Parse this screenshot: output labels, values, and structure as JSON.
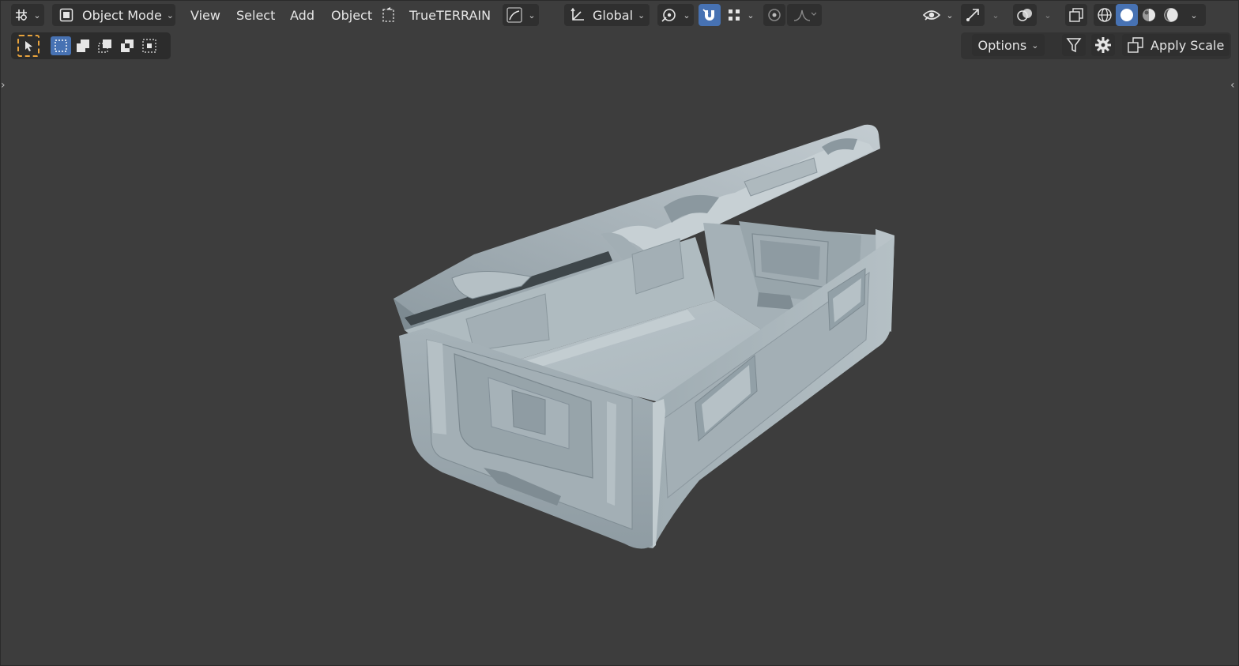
{
  "header": {
    "editor_type_icon": "viewport-grid-icon",
    "mode": {
      "label": "Object Mode",
      "icon": "object-mode-icon"
    },
    "menus": [
      "View",
      "Select",
      "Add",
      "Object"
    ],
    "addon": {
      "label": "TrueTERRAIN",
      "icon": "terrain-select-icon"
    },
    "transform_orientation": "Global",
    "snap_active": true,
    "pivot_icon": "pivot-icon",
    "proportional_icon": "proportional-edit-icon",
    "falloff_icon": "falloff-curve-icon"
  },
  "toolbar": {
    "select_tool_icon": "cursor-select-icon",
    "selection_modes": [
      "select-new-icon",
      "select-extend-icon",
      "select-subtract-icon",
      "select-difference-icon",
      "select-intersect-icon"
    ],
    "options_label": "Options",
    "apply_scale_label": "Apply Scale"
  },
  "shading": {
    "active_mode": "solid",
    "modes": [
      "wireframe",
      "solid",
      "material-preview",
      "rendered"
    ]
  },
  "colors": {
    "background": "#3d3d3d",
    "header_button": "#2f2f2f",
    "accent_blue": "#4772b3",
    "mesh": "#a9b6bc",
    "select_orange": "#e8a33d"
  }
}
